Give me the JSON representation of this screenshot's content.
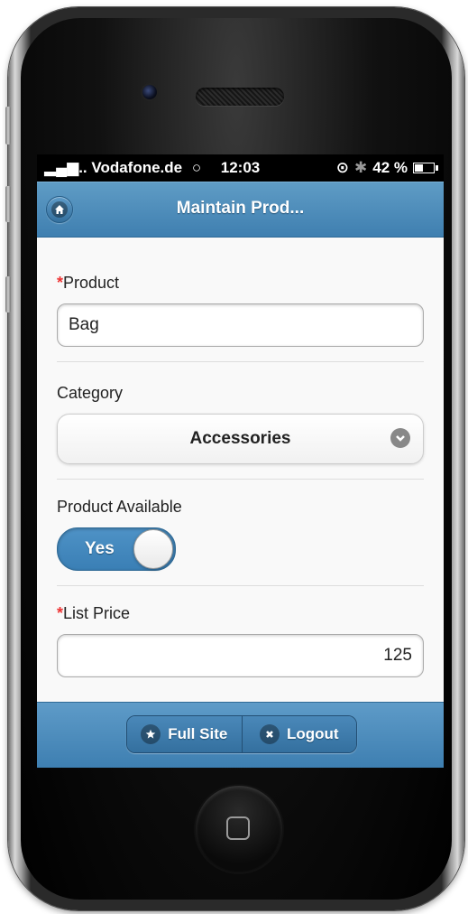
{
  "status_bar": {
    "signal": "▂▄▆.. ",
    "carrier": "Vodafone.de",
    "wifi": "○",
    "time": "12:03",
    "lock": "⊙",
    "bluetooth": "✱",
    "battery": "42 %",
    "battery_level": 0.42
  },
  "header": {
    "title": "Maintain Prod...",
    "home_icon": "home-icon"
  },
  "form": {
    "product": {
      "required_mark": "*",
      "label": "Product",
      "value": "Bag"
    },
    "category": {
      "label": "Category",
      "value": "Accessories"
    },
    "available": {
      "label": "Product Available",
      "value": "Yes"
    },
    "list_price": {
      "required_mark": "*",
      "label": "List Price",
      "value": "125"
    }
  },
  "footer": {
    "full_site": "Full Site",
    "logout": "Logout"
  },
  "colors": {
    "accent": "#4a88b9",
    "required": "#e33333"
  }
}
